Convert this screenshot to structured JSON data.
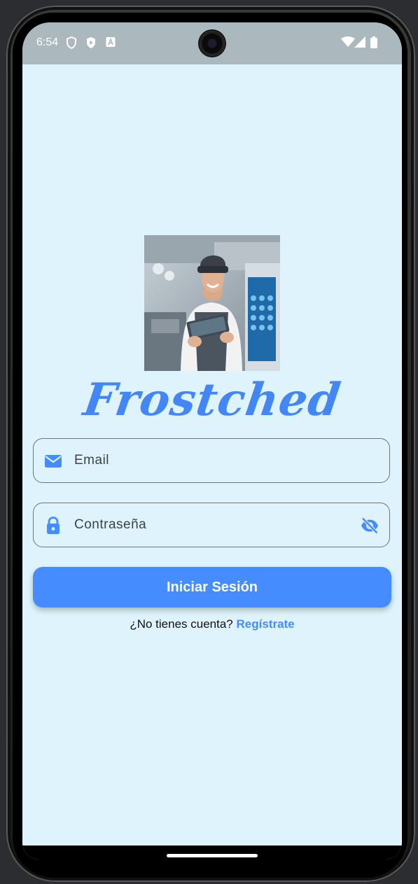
{
  "status_bar": {
    "time": "6:54",
    "icons": [
      "shield-icon",
      "play-protect-icon",
      "a-badge-icon",
      "wifi-icon",
      "signal-icon",
      "battery-icon"
    ]
  },
  "app": {
    "logo_text": "Frostched",
    "brand_color": "#448cff",
    "background_color": "#dff3fd"
  },
  "login": {
    "email_placeholder": "Email",
    "password_placeholder": "Contraseña",
    "submit_label": "Iniciar Sesión",
    "no_account_text": "¿No tienes cuenta?",
    "register_label": "Regístrate"
  }
}
